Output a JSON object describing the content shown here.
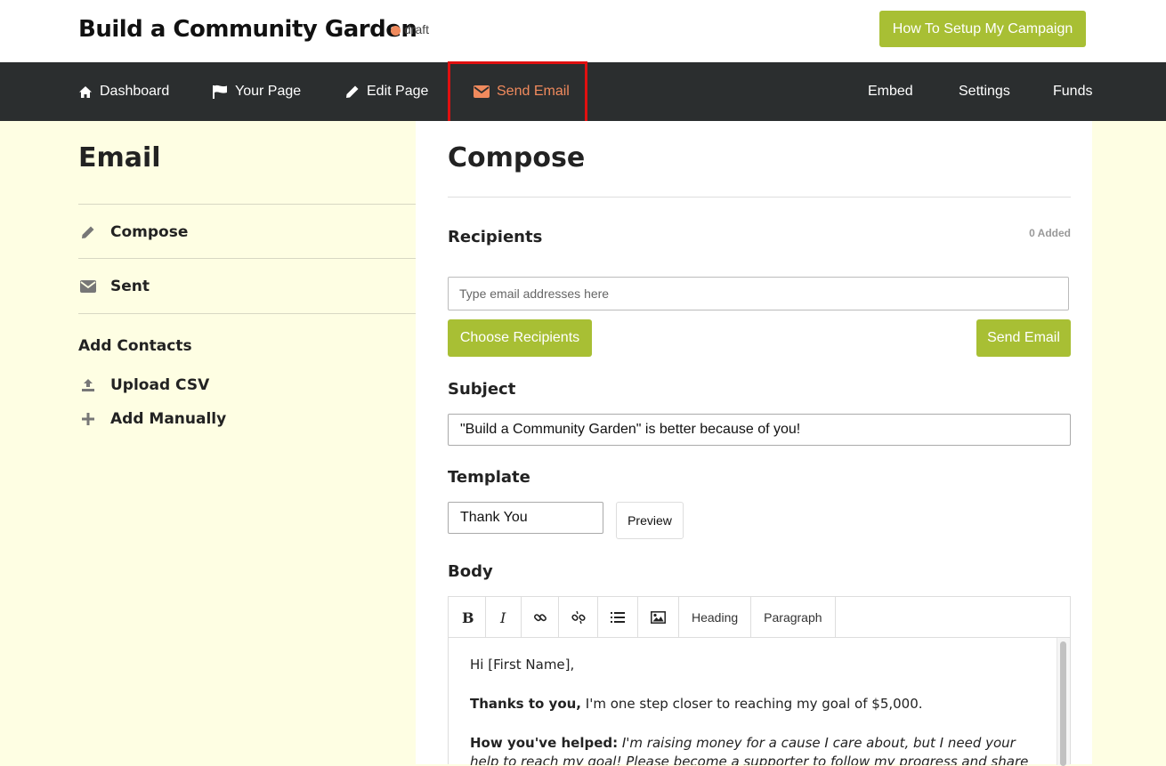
{
  "header": {
    "campaign_title": "Build a Community Garden",
    "status": "draft",
    "setup_button": "How To Setup My Campaign"
  },
  "nav": {
    "left": [
      {
        "label": "Dashboard",
        "icon": "home-icon"
      },
      {
        "label": "Your Page",
        "icon": "flag-icon"
      },
      {
        "label": "Edit Page",
        "icon": "pencil-icon"
      },
      {
        "label": "Send Email",
        "icon": "envelope-icon",
        "active": true
      }
    ],
    "right": [
      {
        "label": "Embed"
      },
      {
        "label": "Settings"
      },
      {
        "label": "Funds"
      }
    ]
  },
  "sidebar": {
    "heading": "Email",
    "items": [
      {
        "label": "Compose",
        "icon": "pencil-icon"
      },
      {
        "label": "Sent",
        "icon": "envelope-icon"
      }
    ],
    "contacts_heading": "Add Contacts",
    "contacts": [
      {
        "label": "Upload CSV",
        "icon": "upload-icon"
      },
      {
        "label": "Add Manually",
        "icon": "plus-icon"
      }
    ]
  },
  "main": {
    "title": "Compose",
    "recipients": {
      "label": "Recipients",
      "count": "0 Added",
      "placeholder": "Type email addresses here",
      "choose_button": "Choose Recipients",
      "send_button": "Send Email"
    },
    "subject": {
      "label": "Subject",
      "value": "\"Build a Community Garden\" is better because of you!"
    },
    "template": {
      "label": "Template",
      "value": "Thank You",
      "preview_button": "Preview"
    },
    "body": {
      "label": "Body",
      "toolbar": [
        "Heading",
        "Paragraph"
      ],
      "greeting": "Hi [First Name],",
      "thanks_bold": "Thanks to you,",
      "thanks_text": " I'm one step closer to reaching my goal of $5,000.",
      "helped_bold": "How you've helped:",
      "helped_text": " I'm raising money for a cause I care about, but I need your help to reach my goal! Please become a supporter to follow my progress and share with your friends."
    }
  },
  "colors": {
    "accent_green": "#a8bf34",
    "nav_bg": "#2b2e2f",
    "active_orange": "#f08a5d",
    "sidebar_bg": "#fefee3",
    "highlight_red": "#e01010"
  }
}
